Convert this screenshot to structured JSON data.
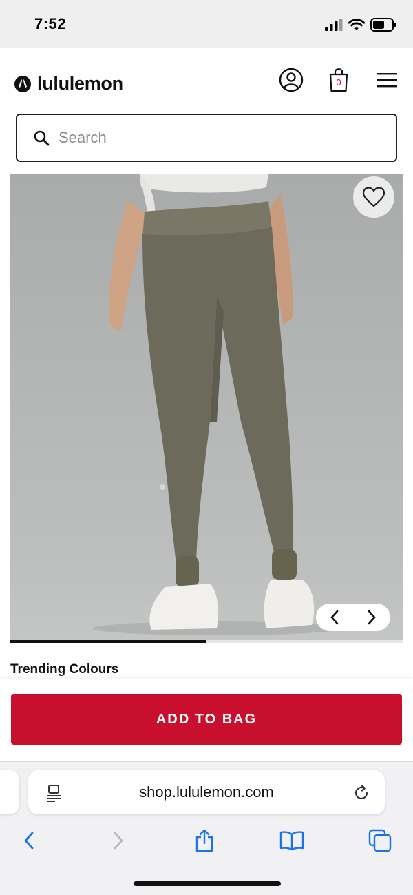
{
  "status_bar": {
    "time": "7:52"
  },
  "header": {
    "brand": "lululemon",
    "bag_count": "0",
    "icons": [
      "account-icon",
      "shopping-bag-icon",
      "menu-icon"
    ]
  },
  "search": {
    "placeholder": "Search"
  },
  "product": {
    "image_alt": "Back view of olive green jogger pants with white sneakers",
    "carousel_progress": 0.5
  },
  "trending": {
    "heading": "Trending Colours"
  },
  "cta": {
    "add_to_bag_label": "ADD TO BAG",
    "color": "#c8102e"
  },
  "browser": {
    "url": "shop.lululemon.com",
    "toolbar_icons": [
      "back-icon",
      "forward-icon",
      "share-icon",
      "bookmarks-icon",
      "tabs-icon"
    ]
  }
}
